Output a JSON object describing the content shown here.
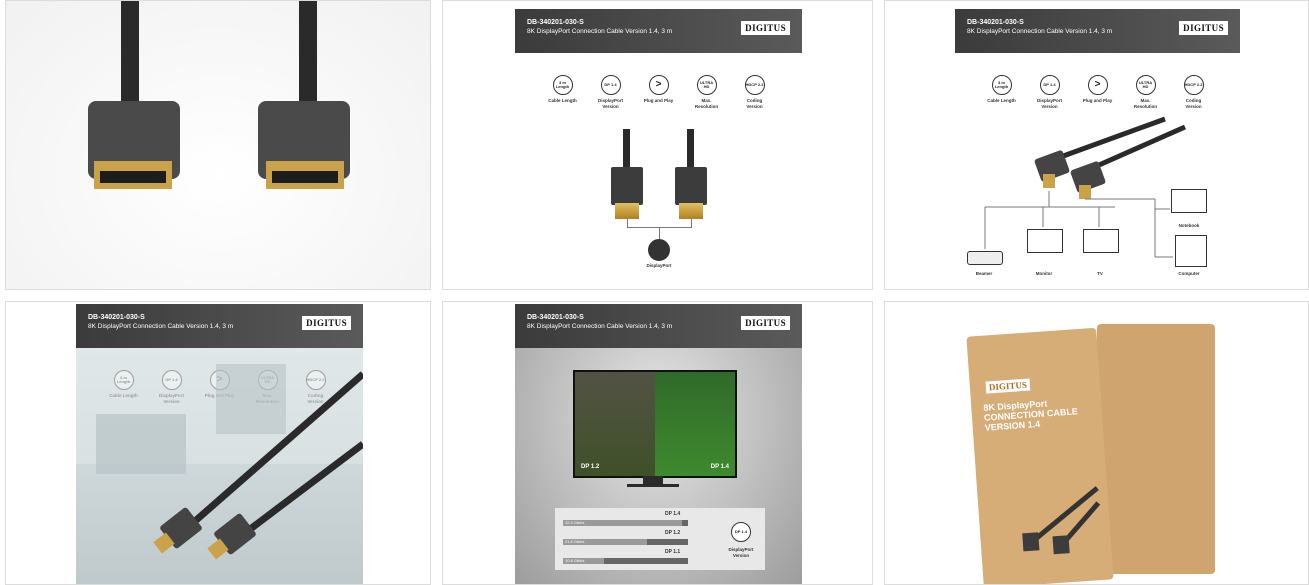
{
  "brand": "DIGITUS",
  "product": {
    "sku": "DB-340201-030-S",
    "subtitle": "8K DisplayPort Connection Cable Version 1.4, 3 m"
  },
  "features": [
    {
      "icon": "cable-length-icon",
      "glyph": "3 m Length",
      "label": "Cable Length"
    },
    {
      "icon": "displayport-version-icon",
      "glyph": "DP 1.4",
      "label": "DisplayPort Version"
    },
    {
      "icon": "plug-and-play-icon",
      "glyph": ">",
      "label": "Plug and Play"
    },
    {
      "icon": "ultra-hd-icon",
      "glyph": "ULTRA HD",
      "label": "Max. Resolution"
    },
    {
      "icon": "hdcp-icon",
      "glyph": "HDCP 2.2",
      "label": "Coding Version"
    }
  ],
  "panel2": {
    "connector_label": "DisplayPort"
  },
  "panel3": {
    "devices": {
      "beamer": "Beamer",
      "monitor": "Monitor",
      "tv": "TV",
      "notebook": "Notebook",
      "computer": "Computer"
    }
  },
  "panel5": {
    "left_label": "DP 1.2",
    "right_label": "DP 1.4",
    "bars": [
      {
        "title": "DP 1.4",
        "value": "32.4 Gbit/s",
        "fraction": 0.95
      },
      {
        "title": "DP 1.2",
        "value": "21.6 Gbit/s",
        "fraction": 0.67
      },
      {
        "title": "DP 1.1",
        "value": "10.8 Gbit/s",
        "fraction": 0.33
      }
    ],
    "badge_label": "DisplayPort Version",
    "badge_glyph": "DP 1.4"
  },
  "panel6": {
    "box_logo": "DIGITUS",
    "box_title": "8K DisplayPort CONNECTION CABLE VERSION 1.4"
  }
}
